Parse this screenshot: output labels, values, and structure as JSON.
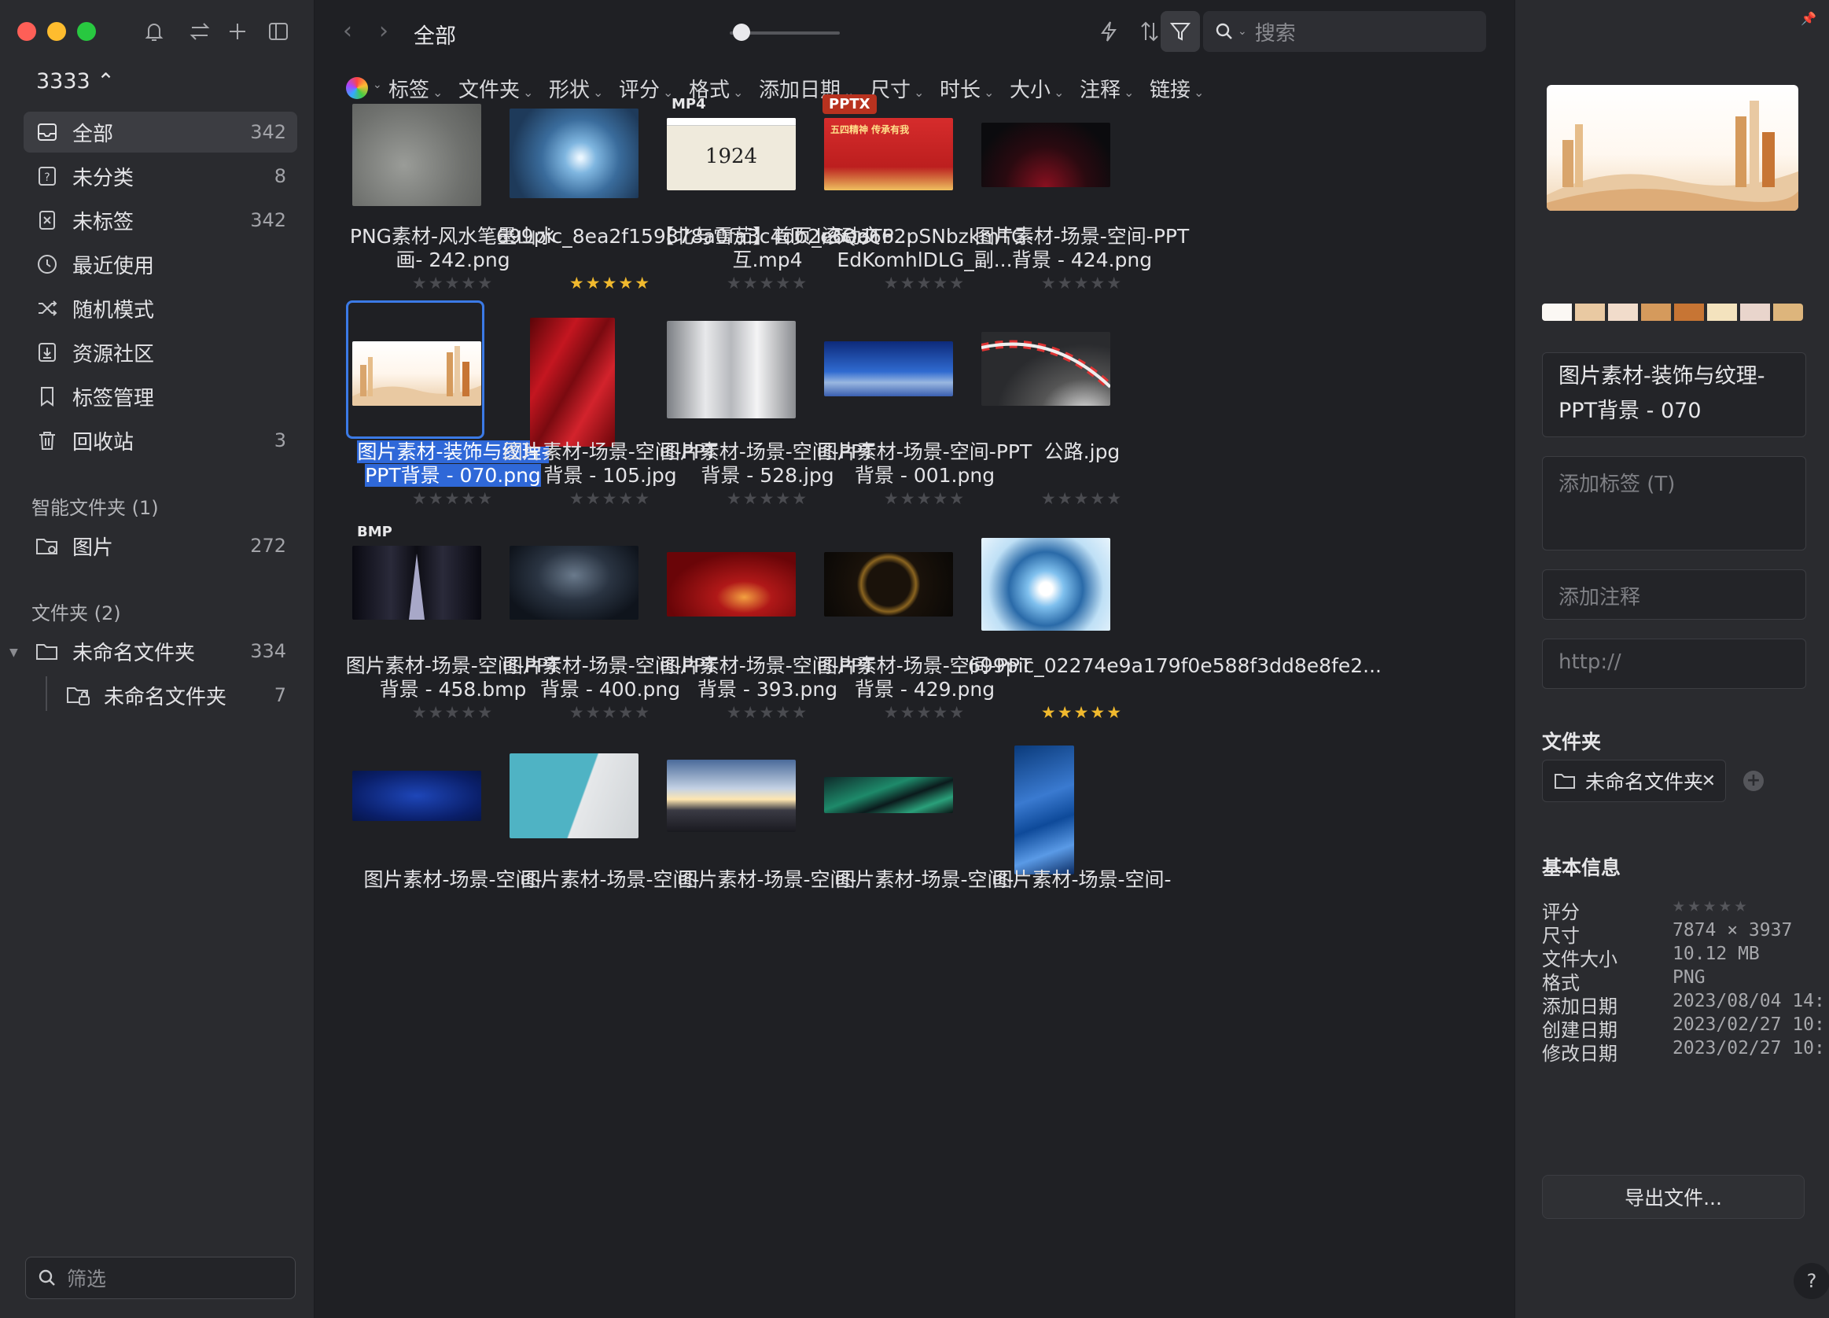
{
  "sidebar": {
    "library": "3333 ⌃",
    "items": [
      {
        "label": "全部",
        "count": "342",
        "icon": "inbox-icon"
      },
      {
        "label": "未分类",
        "count": "8",
        "icon": "question-box-icon"
      },
      {
        "label": "未标签",
        "count": "342",
        "icon": "untagged-icon"
      },
      {
        "label": "最近使用",
        "count": "",
        "icon": "clock-icon"
      },
      {
        "label": "随机模式",
        "count": "",
        "icon": "shuffle-icon"
      },
      {
        "label": "资源社区",
        "count": "",
        "icon": "download-box-icon"
      },
      {
        "label": "标签管理",
        "count": "",
        "icon": "bookmark-icon"
      },
      {
        "label": "回收站",
        "count": "3",
        "icon": "trash-icon"
      }
    ],
    "smart_title": "智能文件夹 (1)",
    "smart_item": {
      "label": "图片",
      "count": "272"
    },
    "folders_title": "文件夹 (2)",
    "folder": {
      "label": "未命名文件夹",
      "count": "334"
    },
    "subfolder": {
      "label": "未命名文件夹",
      "count": "7"
    },
    "filter_placeholder": "筛选"
  },
  "toolbar": {
    "title": "全部",
    "search_placeholder": "搜索"
  },
  "filters": [
    "标签",
    "文件夹",
    "形状",
    "评分",
    "格式",
    "添加日期",
    "尺寸",
    "时长",
    "大小",
    "注释",
    "链接"
  ],
  "grid": [
    {
      "name": "PNG素材-风水笔墨山水画- 242.png",
      "rating": 0,
      "badge": ""
    },
    {
      "name": "699pic_8ea2f159878a0fa3c4db2e6ea66...",
      "rating": 5,
      "badge": ""
    },
    {
      "name": "【北与雪茄】首页_滚动交互.mp4",
      "rating": 0,
      "badge": "MP4",
      "year_text": "1924"
    },
    {
      "name": "lr3QdTP2pSNbzkmTG-EdKomhlDLG_副...",
      "rating": 0,
      "badge": "PPTX",
      "banner_text": "五四精神 传承有我"
    },
    {
      "name": "图片素材-场景-空间-PPT背景 - 424.png",
      "rating": 0,
      "badge": ""
    },
    {
      "name": "图片素材-装饰与纹理-PPT背景 - 070.png",
      "rating": 0,
      "badge": ""
    },
    {
      "name": "图片素材-场景-空间-PPT背景 - 105.jpg",
      "rating": 0,
      "badge": ""
    },
    {
      "name": "图片素材-场景-空间-PPT背景 - 528.jpg",
      "rating": 0,
      "badge": ""
    },
    {
      "name": "图片素材-场景-空间-PPT背景 - 001.png",
      "rating": 0,
      "badge": ""
    },
    {
      "name": "公路.jpg",
      "rating": 0,
      "badge": ""
    },
    {
      "name": "图片素材-场景-空间-PPT背景 - 458.bmp",
      "rating": 0,
      "badge": "BMP"
    },
    {
      "name": "图片素材-场景-空间-PPT背景 - 400.png",
      "rating": 0,
      "badge": ""
    },
    {
      "name": "图片素材-场景-空间-PPT背景 - 393.png",
      "rating": 0,
      "badge": ""
    },
    {
      "name": "图片素材-场景-空间-PPT背景 - 429.png",
      "rating": 0,
      "badge": ""
    },
    {
      "name": "699pic_02274e9a179f0e588f3dd8e8fe2...",
      "rating": 5,
      "badge": ""
    },
    {
      "name": "图片素材-场景-空间-",
      "rating": null,
      "badge": ""
    },
    {
      "name": "图片素材-场景-空间-",
      "rating": null,
      "badge": ""
    },
    {
      "name": "图片素材-场景-空间-",
      "rating": null,
      "badge": ""
    },
    {
      "name": "图片素材-场景-空间-",
      "rating": null,
      "badge": ""
    },
    {
      "name": "图片素材-场景-空间-",
      "rating": null,
      "badge": ""
    }
  ],
  "selected_name_lines": [
    "图片素材-装饰与纹理-",
    "PPT背景 - 070.png"
  ],
  "inspector": {
    "palette": [
      "#fbf8f4",
      "#e9c9a2",
      "#f1dccb",
      "#d59a5c",
      "#c77534",
      "#f4e3be",
      "#e9d5cc",
      "#ddb57c"
    ],
    "title": "图片素材-装饰与纹理-PPT背景 - 070",
    "tag_placeholder": "添加标签 (T)",
    "note_placeholder": "添加注释",
    "url_placeholder": "http://",
    "folder_section": "文件夹",
    "folder_chip": "未命名文件夹",
    "basic_section": "基本信息",
    "info": [
      {
        "k": "评分",
        "v": "★★★★★"
      },
      {
        "k": "尺寸",
        "v": "7874 × 3937"
      },
      {
        "k": "文件大小",
        "v": "10.12 MB"
      },
      {
        "k": "格式",
        "v": "PNG"
      },
      {
        "k": "添加日期",
        "v": "2023/08/04 14:"
      },
      {
        "k": "创建日期",
        "v": "2023/02/27 10:"
      },
      {
        "k": "修改日期",
        "v": "2023/02/27 10:"
      }
    ],
    "export_label": "导出文件...",
    "help_label": "?"
  }
}
